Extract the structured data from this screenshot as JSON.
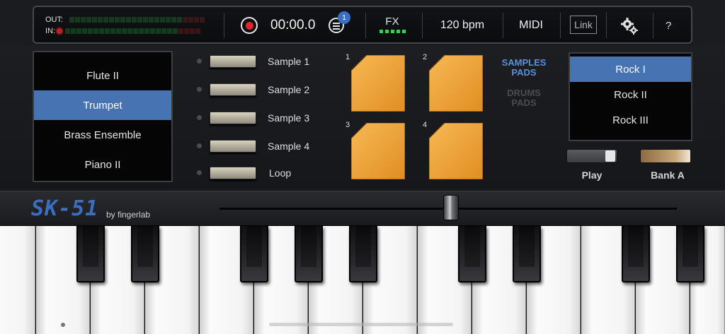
{
  "topbar": {
    "out_label": "OUT:",
    "in_label": "IN:",
    "time": "00:00.0",
    "badge_count": "1",
    "fx_label": "FX",
    "bpm": "120 bpm",
    "midi_label": "MIDI",
    "link_label": "Link",
    "help_label": "?"
  },
  "presets": {
    "items": [
      "Flute II",
      "Trumpet",
      "Brass Ensemble",
      "Piano II"
    ],
    "selected": "Trumpet"
  },
  "samples": [
    "Sample 1",
    "Sample 2",
    "Sample 3",
    "Sample 4",
    "Loop"
  ],
  "pads": [
    "1",
    "2",
    "3",
    "4"
  ],
  "modes": {
    "samples_pads": "SAMPLES PADS",
    "drums_pads": "DRUMS PADS"
  },
  "banks": {
    "items": [
      "Rock I",
      "Rock II",
      "Rock III"
    ],
    "selected": "Rock I"
  },
  "controls": {
    "play_label": "Play",
    "bank_label": "Bank A"
  },
  "brand": {
    "logo": "SK-51",
    "byline": "by fingerlab"
  },
  "colors": {
    "accent": "#4773b3",
    "pad_orange": "#f0a23a",
    "record_red": "#e2232a",
    "fx_green": "#43c85c"
  },
  "icons": {
    "record": "record-icon",
    "list": "list-icon",
    "settings": "gear-icon"
  }
}
